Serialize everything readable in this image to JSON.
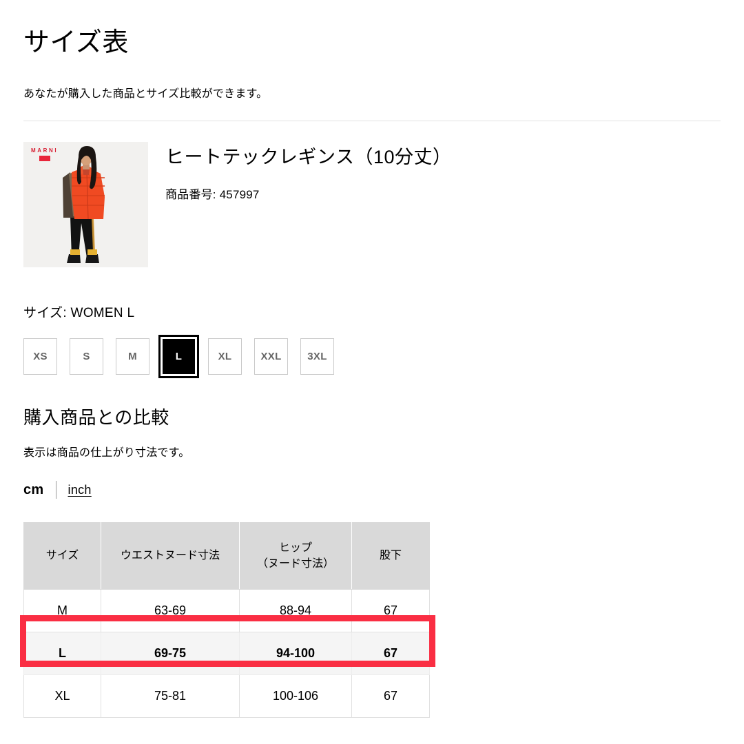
{
  "header": {
    "title": "サイズ表",
    "subtitle": "あなたが購入した商品とサイズ比較ができます。"
  },
  "product": {
    "name": "ヒートテックレギンス（10分丈）",
    "code_label": "商品番号: 457997",
    "brand_logo_text": "MARNI",
    "image_alt": "モデル着用画像"
  },
  "size_selector": {
    "label": "サイズ: WOMEN L",
    "selected": "L",
    "options": [
      {
        "label": "XS",
        "selected": false
      },
      {
        "label": "S",
        "selected": false
      },
      {
        "label": "M",
        "selected": false
      },
      {
        "label": "L",
        "selected": true
      },
      {
        "label": "XL",
        "selected": false
      },
      {
        "label": "XXL",
        "selected": false
      },
      {
        "label": "3XL",
        "selected": false
      }
    ]
  },
  "comparison": {
    "heading": "購入商品との比較",
    "subtitle": "表示は商品の仕上がり寸法です。",
    "units": {
      "active": "cm",
      "cm_label": "cm",
      "inch_label": "inch"
    },
    "table": {
      "headers": [
        "サイズ",
        "ウエストヌード寸法",
        "ヒップ\n（ヌード寸法）",
        "股下"
      ],
      "header_parts": {
        "col3_line1": "ヒップ",
        "col3_line2": "（ヌード寸法）"
      },
      "rows": [
        {
          "size": "M",
          "waist": "63-69",
          "hip": "88-94",
          "inseam": "67",
          "highlighted": false
        },
        {
          "size": "L",
          "waist": "69-75",
          "hip": "94-100",
          "inseam": "67",
          "highlighted": true
        },
        {
          "size": "XL",
          "waist": "75-81",
          "hip": "100-106",
          "inseam": "67",
          "highlighted": false
        }
      ],
      "highlight_color": "#fa2e43",
      "highlight_row_bg": "#f5f5f5",
      "header_bg": "#d9d9d9"
    }
  }
}
